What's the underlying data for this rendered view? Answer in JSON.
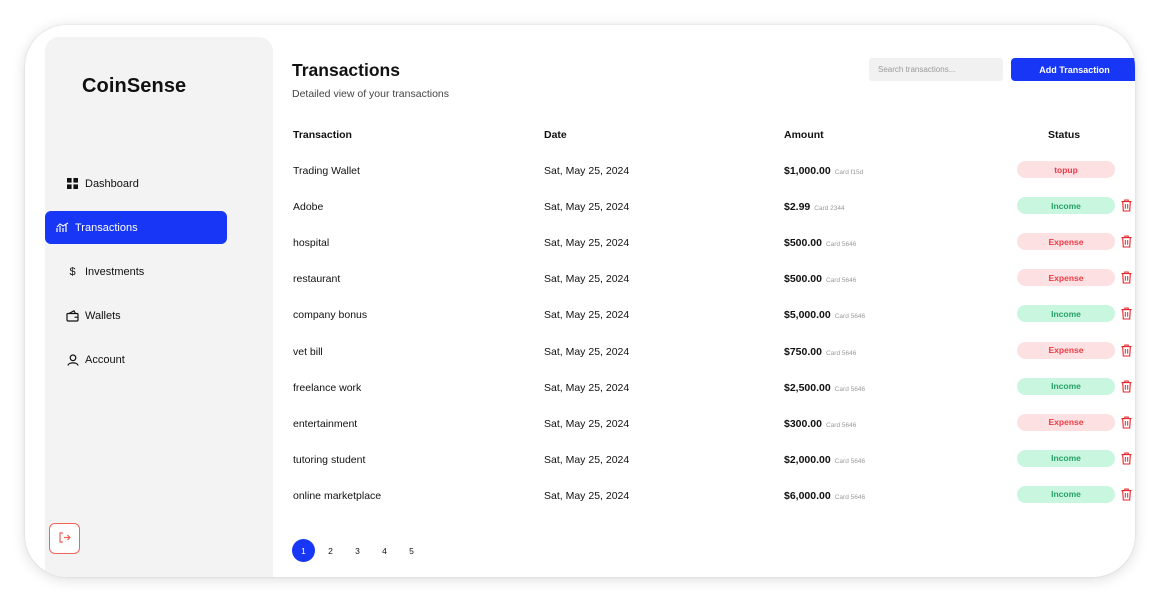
{
  "brand": "CoinSense",
  "sidebar": {
    "items": [
      {
        "label": "Dashboard",
        "icon": "grid-icon"
      },
      {
        "label": "Transactions",
        "icon": "trend-icon"
      },
      {
        "label": "Investments",
        "icon": "dollar-icon"
      },
      {
        "label": "Wallets",
        "icon": "wallet-icon"
      },
      {
        "label": "Account",
        "icon": "user-icon"
      }
    ],
    "active_item": "Transactions"
  },
  "header": {
    "title": "Transactions",
    "subtitle": "Detailed view of your transactions",
    "search_placeholder": "Search transactions...",
    "add_button": "Add Transaction"
  },
  "table": {
    "columns": [
      "Transaction",
      "Date",
      "Amount",
      "Status"
    ],
    "rows": [
      {
        "name": "Trading Wallet",
        "date": "Sat, May 25, 2024",
        "amount": "$1,000.00",
        "card": "Card f15d",
        "status": "topup",
        "deletable": false
      },
      {
        "name": "Adobe",
        "date": "Sat, May 25, 2024",
        "amount": "$2.99",
        "card": "Card 2344",
        "status": "Income",
        "deletable": true
      },
      {
        "name": "hospital",
        "date": "Sat, May 25, 2024",
        "amount": "$500.00",
        "card": "Card 5646",
        "status": "Expense",
        "deletable": true
      },
      {
        "name": "restaurant",
        "date": "Sat, May 25, 2024",
        "amount": "$500.00",
        "card": "Card 5646",
        "status": "Expense",
        "deletable": true
      },
      {
        "name": "company bonus",
        "date": "Sat, May 25, 2024",
        "amount": "$5,000.00",
        "card": "Card 5646",
        "status": "Income",
        "deletable": true
      },
      {
        "name": "vet bill",
        "date": "Sat, May 25, 2024",
        "amount": "$750.00",
        "card": "Card 5646",
        "status": "Expense",
        "deletable": true
      },
      {
        "name": "freelance work",
        "date": "Sat, May 25, 2024",
        "amount": "$2,500.00",
        "card": "Card 5646",
        "status": "Income",
        "deletable": true
      },
      {
        "name": "entertainment",
        "date": "Sat, May 25, 2024",
        "amount": "$300.00",
        "card": "Card 5646",
        "status": "Expense",
        "deletable": true
      },
      {
        "name": "tutoring student",
        "date": "Sat, May 25, 2024",
        "amount": "$2,000.00",
        "card": "Card 5646",
        "status": "Income",
        "deletable": true
      },
      {
        "name": "online marketplace",
        "date": "Sat, May 25, 2024",
        "amount": "$6,000.00",
        "card": "Card 5646",
        "status": "Income",
        "deletable": true
      }
    ]
  },
  "pagination": {
    "pages": [
      "1",
      "2",
      "3",
      "4",
      "5"
    ],
    "current": "1"
  },
  "colors": {
    "accent": "#1736f5",
    "income_bg": "#c8f6df",
    "income_text": "#26a267",
    "expense_bg": "#fde0e2",
    "expense_text": "#ef3b47",
    "trash": "#e5252a"
  }
}
